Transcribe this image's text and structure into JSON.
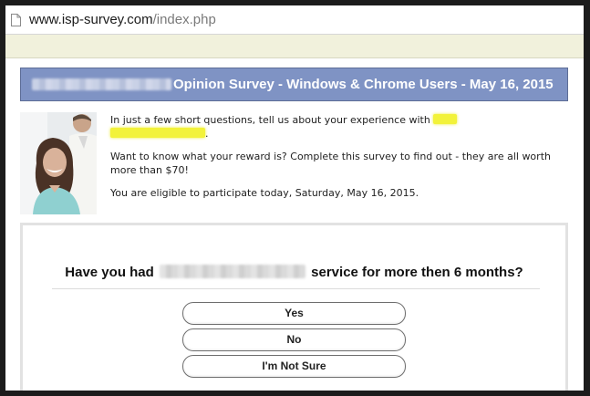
{
  "browser": {
    "url_domain": "www.isp-survey.com",
    "url_path": "/index.php",
    "page_icon": "document-icon"
  },
  "header": {
    "title": "Opinion Survey - Windows & Chrome Users - May 16, 2015",
    "background_color": "#7f93c4"
  },
  "intro": {
    "line1": "In just a few short questions, tell us about your experience with",
    "line1_end": ".",
    "reward": "Want to know what your reward is? Complete this survey to find out - they are all worth more than $70!",
    "eligible": "You are eligible to participate today, Saturday, May 16, 2015."
  },
  "survey": {
    "question_start": "Have you had",
    "question_end": "service for more then 6 months?",
    "answers": [
      "Yes",
      "No",
      "I'm Not Sure"
    ]
  }
}
